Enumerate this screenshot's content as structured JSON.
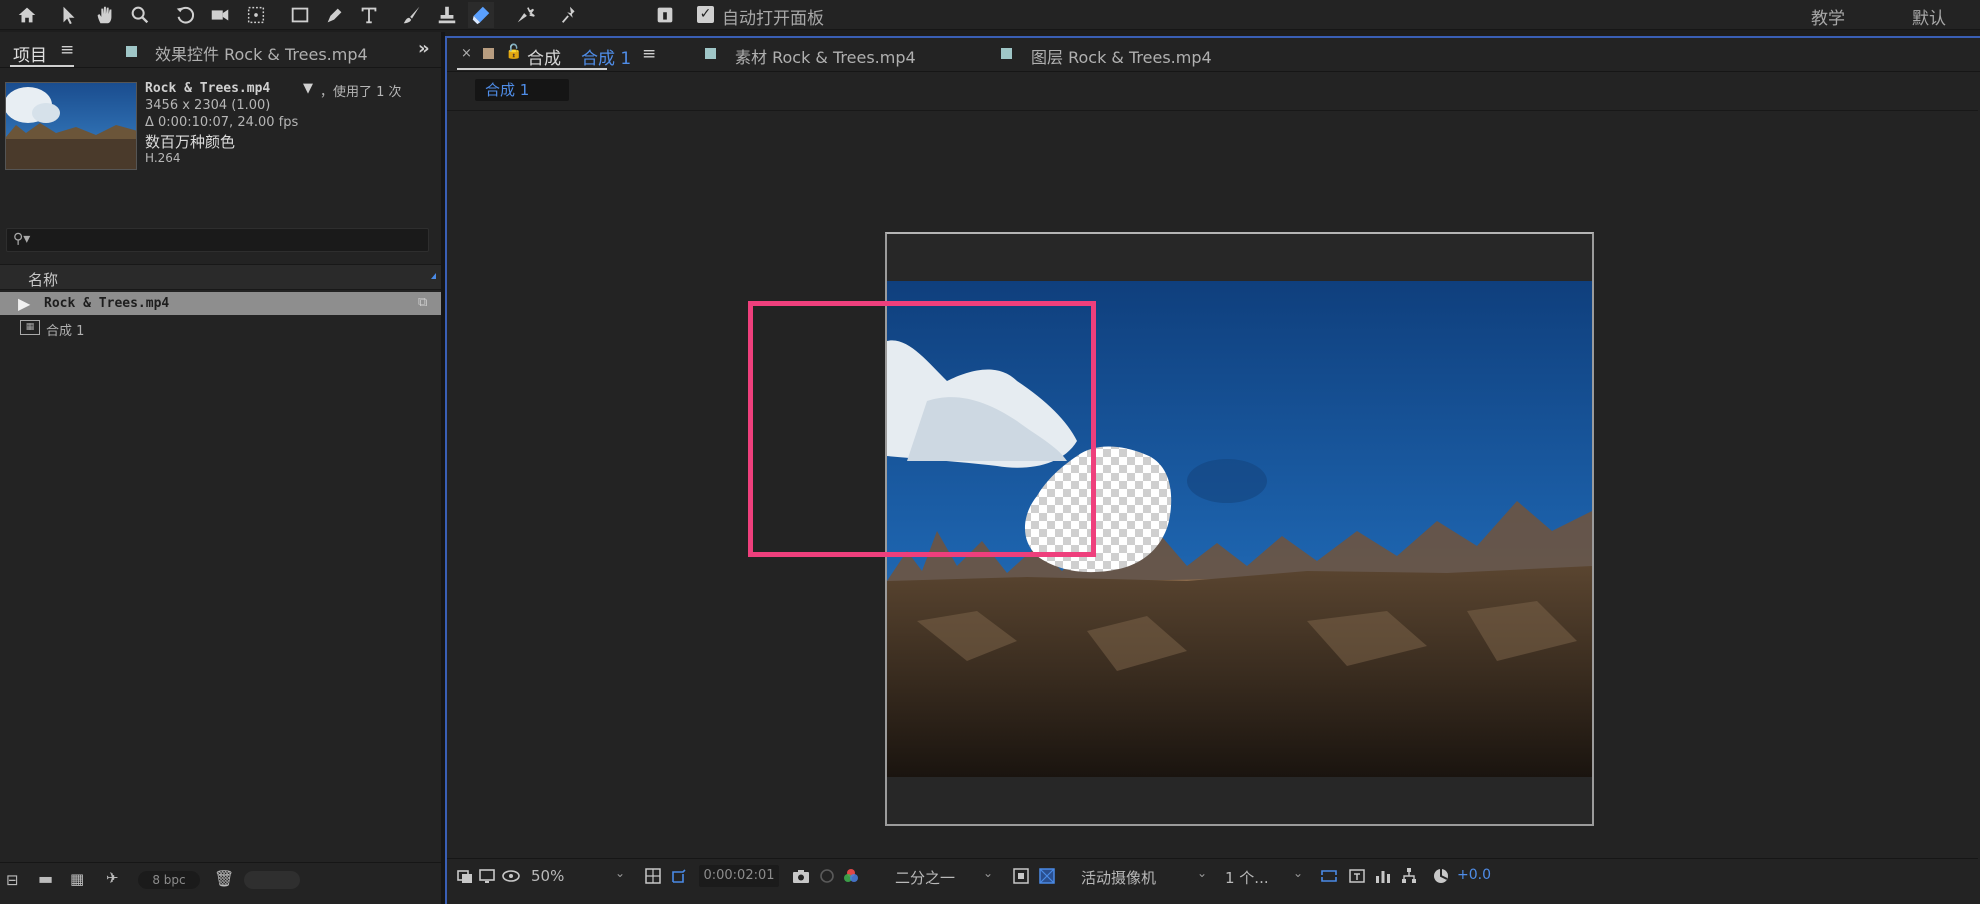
{
  "toolbar": {
    "checkbox_label": "自动打开面板",
    "workspace_learn": "教学",
    "workspace_default": "默认"
  },
  "project_panel": {
    "tab_label": "项目",
    "effects_tab": "效果控件 Rock & Trees.mp4",
    "file_name": "Rock & Trees.mp4",
    "usage": "，使用了 1 次",
    "dimensions": "3456 x 2304 (1.00)",
    "duration": "Δ 0:00:10:07, 24.00 fps",
    "colors": "数百万种颜色",
    "codec": "H.264",
    "search_placeholder": "",
    "column_name": "名称",
    "items": [
      {
        "name": "Rock & Trees.mp4",
        "type": "footage"
      },
      {
        "name": "合成 1",
        "type": "composition"
      }
    ],
    "bpc": "8 bpc"
  },
  "composition_panel": {
    "tab_active_prefix": "合成",
    "tab_active_name": "合成 1",
    "tab_footage": "素材 Rock & Trees.mp4",
    "tab_layer": "图层 Rock & Trees.mp4",
    "breadcrumb": "合成 1",
    "zoom": "50%",
    "timecode": "0:00:02:01",
    "resolution": "二分之一",
    "camera": "活动摄像机",
    "views": "1 个...",
    "exposure": "+0.0"
  },
  "colors": {
    "accent_blue": "#3a5fb5",
    "highlight_pink": "#ee3f7c",
    "panel_bg": "#232323"
  }
}
